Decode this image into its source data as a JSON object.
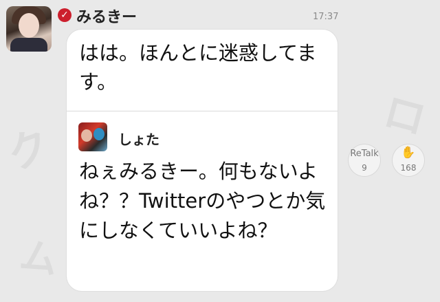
{
  "post": {
    "username": "みるきー",
    "verified_badge": "✓",
    "time": "17:37",
    "message": "はは。ほんとに迷惑してます。"
  },
  "quote": {
    "username": "しょた",
    "message": "ねぇみるきー。何もないよね？？Twitterのやつとか気にしなくていいよね？"
  },
  "actions": {
    "retalk_label": "ReTalk",
    "retalk_count": "9",
    "clap_icon": "✋",
    "clap_count": "168"
  },
  "colors": {
    "badge": "#cc1f2d",
    "background": "#e9e9e9",
    "bubble": "#ffffff"
  },
  "icons": [
    "verified-check-icon",
    "clap-icon"
  ]
}
